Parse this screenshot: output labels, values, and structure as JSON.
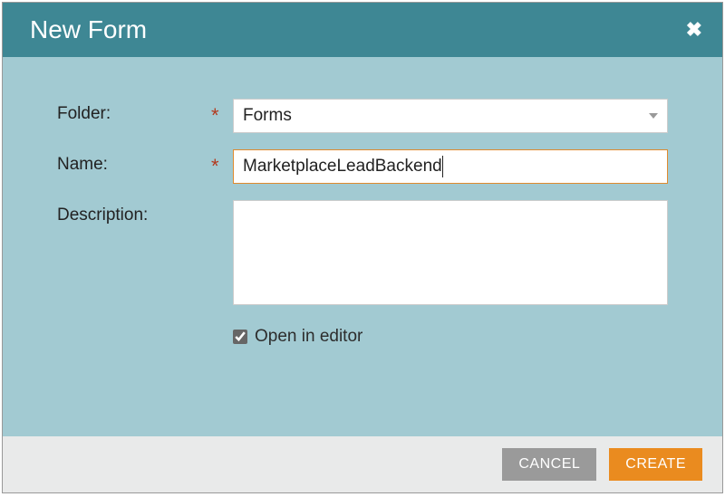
{
  "dialog": {
    "title": "New Form"
  },
  "labels": {
    "folder": "Folder:",
    "name": "Name:",
    "description": "Description:",
    "open_in_editor": "Open in editor"
  },
  "required_marker": "*",
  "fields": {
    "folder": {
      "value": "Forms"
    },
    "name": {
      "value": "MarketplaceLeadBackend"
    },
    "description": {
      "value": ""
    },
    "open_in_editor": {
      "checked": true
    }
  },
  "buttons": {
    "cancel": "CANCEL",
    "create": "CREATE"
  }
}
